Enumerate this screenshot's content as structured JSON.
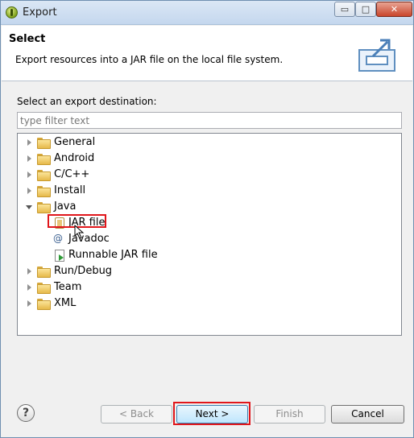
{
  "window": {
    "title": "Export",
    "controls": {
      "minimize": "▭",
      "maximize": "□",
      "close": "✕"
    }
  },
  "banner": {
    "title": "Select",
    "description": "Export resources into a JAR file on the local file system.",
    "icon": "export-icon"
  },
  "destination": {
    "label": "Select an export destination:",
    "filter_placeholder": "type filter text",
    "filter_value": ""
  },
  "tree": {
    "items": [
      {
        "label": "General",
        "icon": "folder-icon",
        "expanded": false
      },
      {
        "label": "Android",
        "icon": "folder-icon",
        "expanded": false
      },
      {
        "label": "C/C++",
        "icon": "folder-icon",
        "expanded": false
      },
      {
        "label": "Install",
        "icon": "folder-icon",
        "expanded": false
      },
      {
        "label": "Java",
        "icon": "folder-icon",
        "expanded": true,
        "children": [
          {
            "label": "JAR file",
            "icon": "jar-icon",
            "selected": true
          },
          {
            "label": "Javadoc",
            "icon": "javadoc-icon"
          },
          {
            "label": "Runnable JAR file",
            "icon": "runnable-jar-icon"
          }
        ]
      },
      {
        "label": "Run/Debug",
        "icon": "folder-icon",
        "expanded": false
      },
      {
        "label": "Team",
        "icon": "folder-icon",
        "expanded": false
      },
      {
        "label": "XML",
        "icon": "folder-icon",
        "expanded": false
      }
    ]
  },
  "footer": {
    "help": "?",
    "back": "< Back",
    "next": "Next >",
    "finish": "Finish",
    "cancel": "Cancel"
  },
  "colors": {
    "highlight": "#e0161b",
    "accent": "#3c7fb1"
  }
}
